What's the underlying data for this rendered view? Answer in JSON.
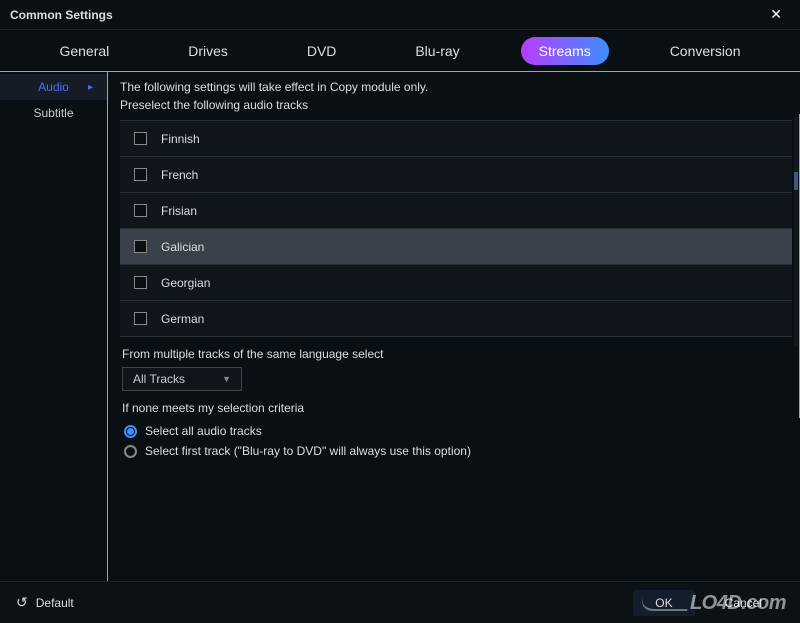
{
  "title": "Common Settings",
  "tabs": [
    {
      "label": "General"
    },
    {
      "label": "Drives"
    },
    {
      "label": "DVD"
    },
    {
      "label": "Blu-ray"
    },
    {
      "label": "Streams"
    },
    {
      "label": "Conversion"
    }
  ],
  "active_tab_index": 4,
  "sidebar": {
    "items": [
      {
        "label": "Audio"
      },
      {
        "label": "Subtitle"
      }
    ],
    "active_index": 0
  },
  "content": {
    "intro1": "The following settings will take effect in Copy module only.",
    "intro2": "Preselect the following audio tracks",
    "languages": [
      {
        "label": "Finnish",
        "checked": false
      },
      {
        "label": "French",
        "checked": false
      },
      {
        "label": "Frisian",
        "checked": false
      },
      {
        "label": "Galician",
        "checked": false,
        "highlight": true
      },
      {
        "label": "Georgian",
        "checked": false
      },
      {
        "label": "German",
        "checked": false
      }
    ],
    "multi_track_label": "From multiple tracks of the same language select",
    "dropdown_value": "All Tracks",
    "none_meets_label": "If none meets my selection criteria",
    "radios": [
      {
        "label": "Select all audio tracks",
        "selected": true
      },
      {
        "label": "Select first track (\"Blu-ray to DVD\" will always use this option)",
        "selected": false
      }
    ]
  },
  "footer": {
    "default_label": "Default",
    "ok_label": "OK",
    "cancel_label": "Cancel"
  },
  "watermark": "LO4D.com"
}
